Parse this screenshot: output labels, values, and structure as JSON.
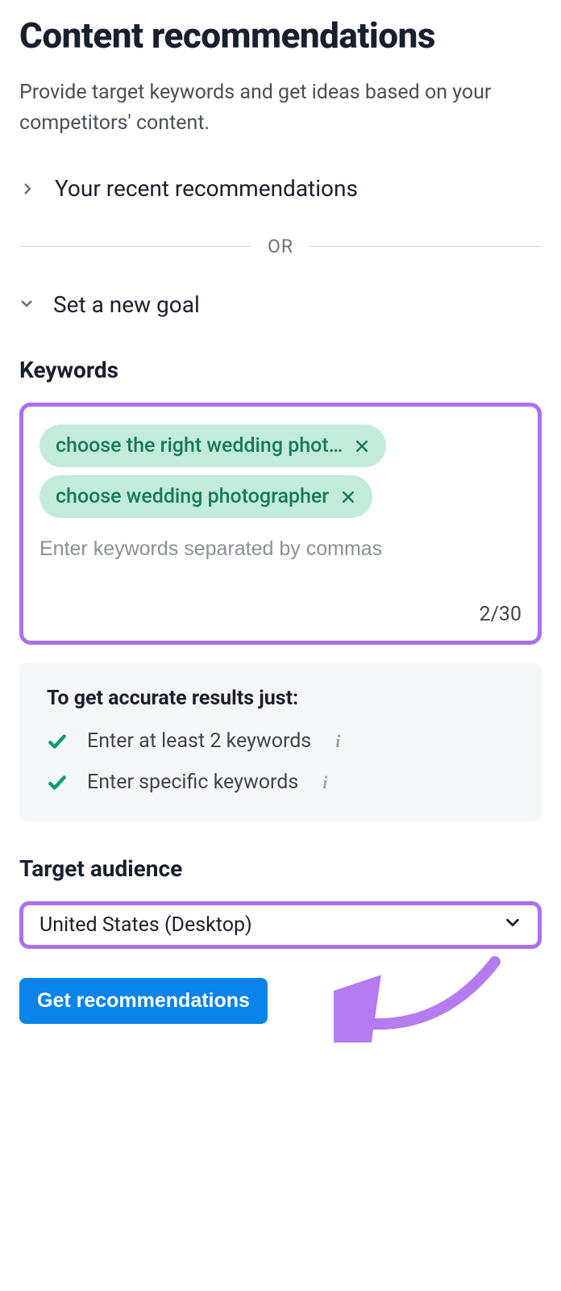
{
  "header": {
    "title": "Content recommendations",
    "subtitle": "Provide target keywords and get ideas based on your competitors' content."
  },
  "accordion": {
    "recent_label": "Your recent recommendations",
    "divider_text": "OR",
    "new_goal_label": "Set a new goal"
  },
  "keywords": {
    "section_heading": "Keywords",
    "chips": [
      "choose the right wedding phot…",
      "choose wedding photographer"
    ],
    "placeholder": "Enter keywords separated by commas",
    "counter": "2/30"
  },
  "tips": {
    "title": "To get accurate results just:",
    "items": [
      "Enter at least 2 keywords",
      "Enter specific keywords"
    ]
  },
  "audience": {
    "section_heading": "Target audience",
    "selected": "United States (Desktop)"
  },
  "cta": {
    "label": "Get recommendations"
  }
}
